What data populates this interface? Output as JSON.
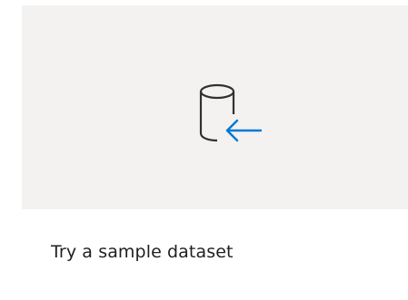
{
  "card": {
    "label": "Try a sample dataset",
    "icon": "database-import-icon",
    "icon_stroke_color": "#323130",
    "icon_accent_color": "#0078d4",
    "hero_background": "#f3f2f1"
  }
}
